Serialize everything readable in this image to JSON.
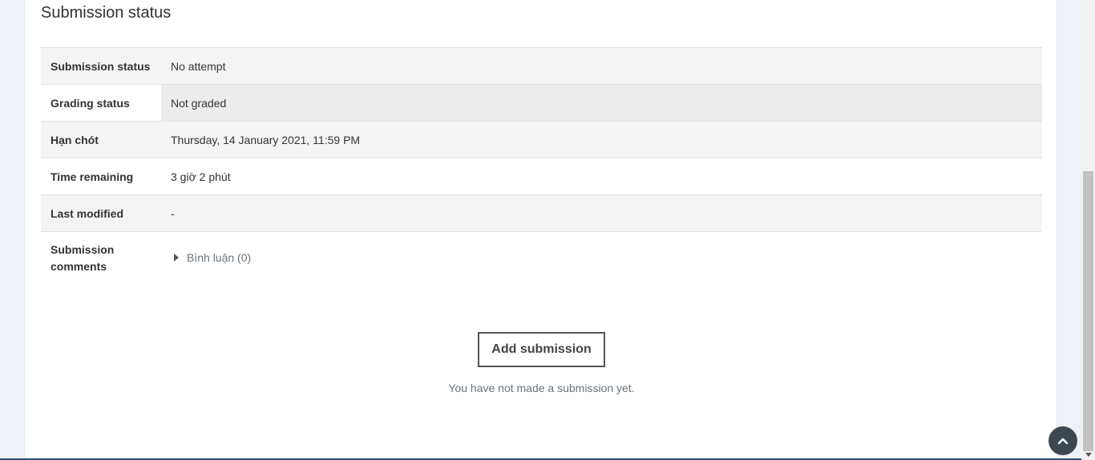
{
  "section": {
    "title": "Submission status"
  },
  "rows": [
    {
      "label": "Submission status",
      "value": "No attempt"
    },
    {
      "label": "Grading status",
      "value": "Not graded"
    },
    {
      "label": "Hạn chót",
      "value": "Thursday, 14 January 2021, 11:59 PM"
    },
    {
      "label": "Time remaining",
      "value": "3 giờ 2 phút"
    },
    {
      "label": "Last modified",
      "value": "-"
    },
    {
      "label": "Submission comments",
      "value": "Bình luận (0)"
    }
  ],
  "actions": {
    "add_submission_label": "Add submission",
    "no_submission_text": "You have not made a submission yet."
  },
  "icons": {
    "comments_toggle": "caret-right-icon",
    "back_to_top": "chevron-up-icon"
  },
  "colors": {
    "back_to_top_bg": "#3d4750",
    "shaded_row": "#f4f4f4"
  }
}
